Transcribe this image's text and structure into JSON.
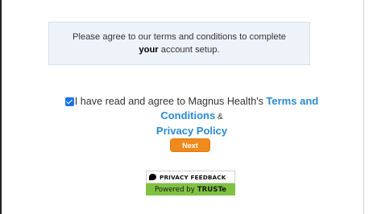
{
  "notice": {
    "prefix": "Please agree to our terms and conditions to complete ",
    "emphasis": "your",
    "suffix": " account setup."
  },
  "agreement": {
    "checked": true,
    "text_prefix": "I have read and agree to Magnus Health's ",
    "terms_link": "Terms and Conditions",
    "separator": " & ",
    "privacy_link": "Privacy Policy"
  },
  "next_button": {
    "label": "Next"
  },
  "truste_badge": {
    "top_label": "PRIVACY FEEDBACK",
    "bottom_prefix": "Powered by",
    "bottom_brand": "TRUSTe",
    "icon": "speech-bubble-icon"
  },
  "colors": {
    "accent_blue": "#2b8ad0",
    "button_orange": "#f08a1c",
    "truste_green": "#7fc241",
    "notice_bg": "#eef3f9"
  }
}
